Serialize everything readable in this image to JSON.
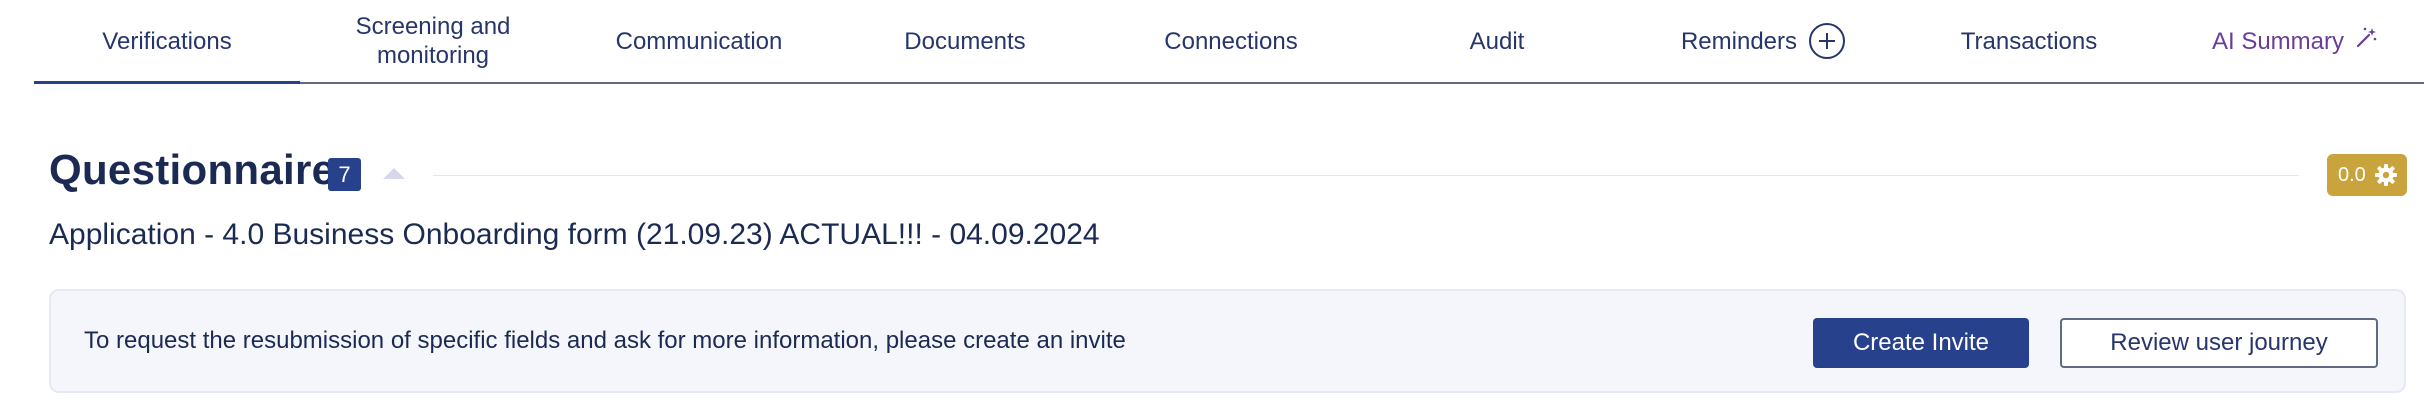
{
  "tabs": {
    "verifications": "Verifications",
    "screening_line1": "Screening and",
    "screening_line2": "monitoring",
    "communication": "Communication",
    "documents": "Documents",
    "connections": "Connections",
    "audit": "Audit",
    "reminders": "Reminders",
    "transactions": "Transactions",
    "ai_summary": "AI Summary",
    "active": "Verifications"
  },
  "section": {
    "title": "Questionnaire",
    "count": "7",
    "score": "0.0",
    "subtitle": "Application - 4.0 Business Onboarding form (21.09.23) ACTUAL!!! - 04.09.2024"
  },
  "info_panel": {
    "text": "To request the resubmission of specific fields and ask for more information, please create an invite",
    "create_invite": "Create Invite",
    "review_journey": "Review user journey"
  },
  "icons": {
    "reminders_add": "plus-circle-icon",
    "ai_summary": "magic-wand-icon",
    "collapse": "caret-up-icon",
    "score_settings": "gear-icon"
  },
  "colors": {
    "primary": "#27418c",
    "text": "#1b2a52",
    "score_badge": "#c9a33c",
    "ai_accent": "#6a3d9a",
    "panel_bg": "#f5f6fb"
  }
}
